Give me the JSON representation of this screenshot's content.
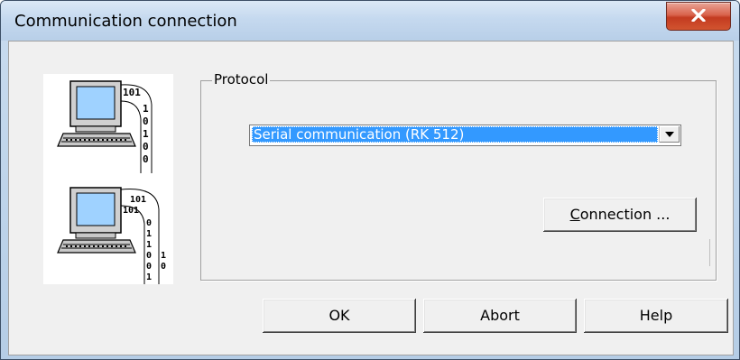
{
  "window": {
    "title": "Communication connection",
    "close_icon": "close-icon"
  },
  "protocol": {
    "group_label": "Protocol",
    "selected": "Serial communication (RK 512)",
    "connection_button_underlined": "C",
    "connection_button_rest": "onnection ..."
  },
  "buttons": {
    "ok": "OK",
    "abort": "Abort",
    "help": "Help"
  },
  "illustration": {
    "computer1_bits": [
      "101",
      "1",
      "0",
      "1",
      "0",
      "0"
    ],
    "computer2_bits": [
      "101",
      "101",
      "0",
      "1",
      "1",
      "0",
      "0",
      "1",
      "1",
      "0"
    ]
  },
  "colors": {
    "selection": "#3399ff",
    "title_gradient": "#c5d9ef",
    "close_red": "#c33b21"
  }
}
